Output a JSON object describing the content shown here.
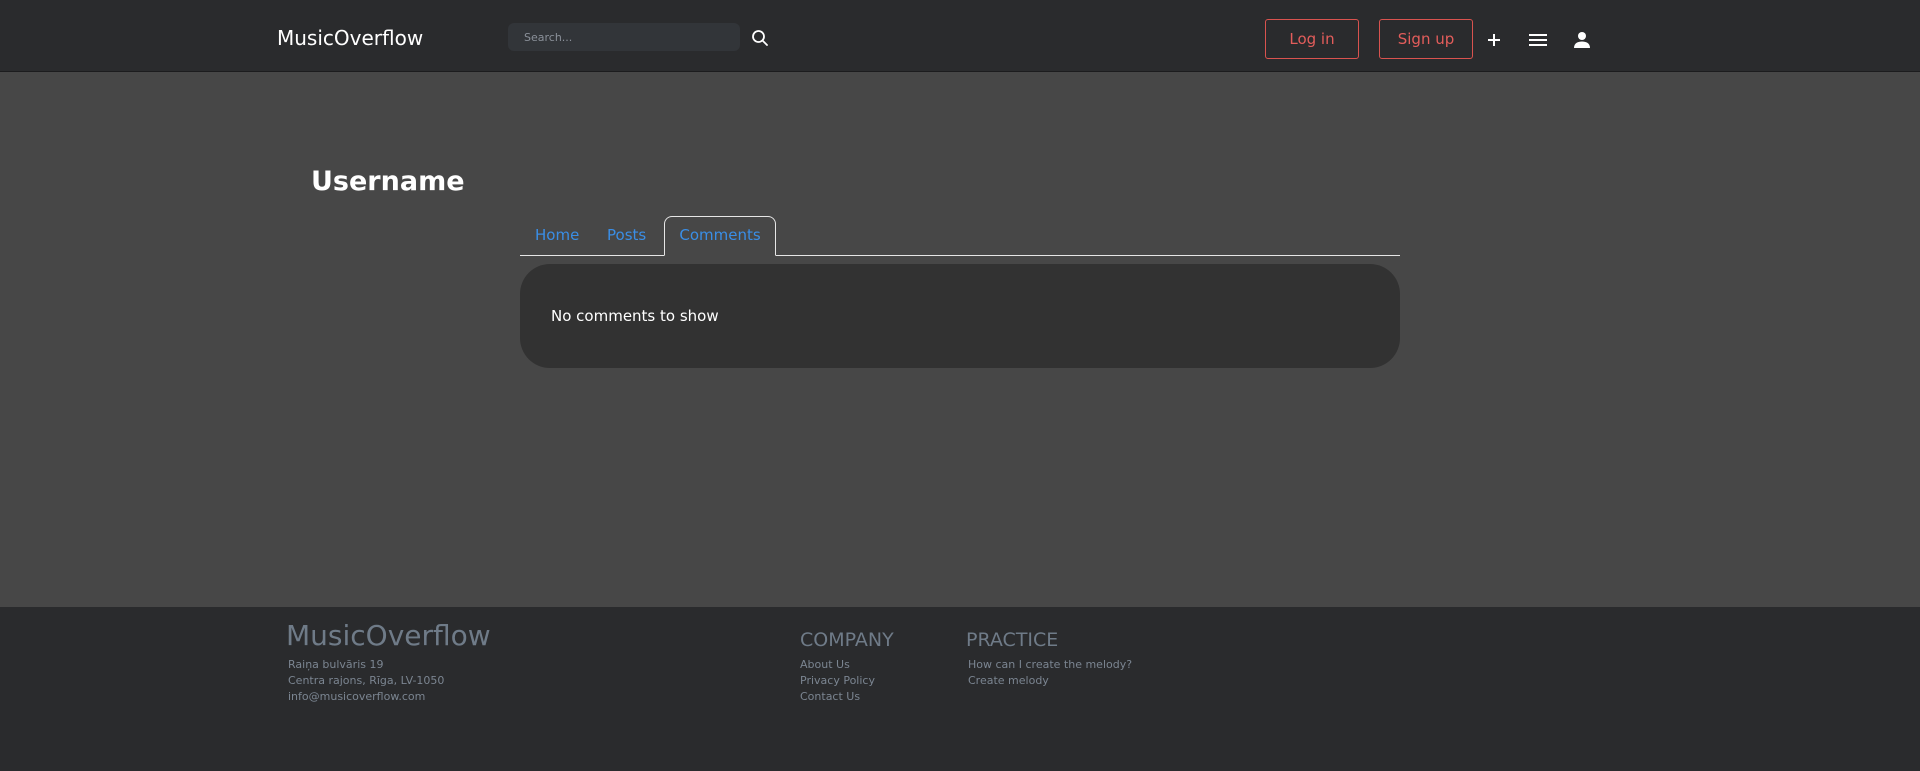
{
  "header": {
    "brand": "MusicOverflow",
    "search": {
      "placeholder": "Search..."
    },
    "login_label": "Log in",
    "signup_label": "Sign up"
  },
  "profile": {
    "username": "Username",
    "tabs": [
      {
        "label": "Home",
        "active": false
      },
      {
        "label": "Posts",
        "active": false
      },
      {
        "label": "Comments",
        "active": true
      }
    ],
    "empty_message": "No comments to show"
  },
  "footer": {
    "brand": "MusicOverflow",
    "address": [
      "Raiņa bulvāris 19",
      "Centra rajons, Rīga, LV-1050",
      "info@musicoverflow.com"
    ],
    "company": {
      "heading": "COMPANY",
      "links": [
        "About Us",
        "Privacy Policy",
        "Contact Us"
      ]
    },
    "practice": {
      "heading": "PRACTICE",
      "links": [
        "How can I create the melody?",
        "Create melody"
      ]
    }
  },
  "colors": {
    "page_bg": "#474747",
    "nav_bg": "#2a2b2d",
    "accent_red": "#e35d5b",
    "tab_blue": "#3a8ee6",
    "card_bg": "#323232"
  },
  "icons": [
    "search-icon",
    "plus-icon",
    "menu-icon",
    "person-icon"
  ]
}
